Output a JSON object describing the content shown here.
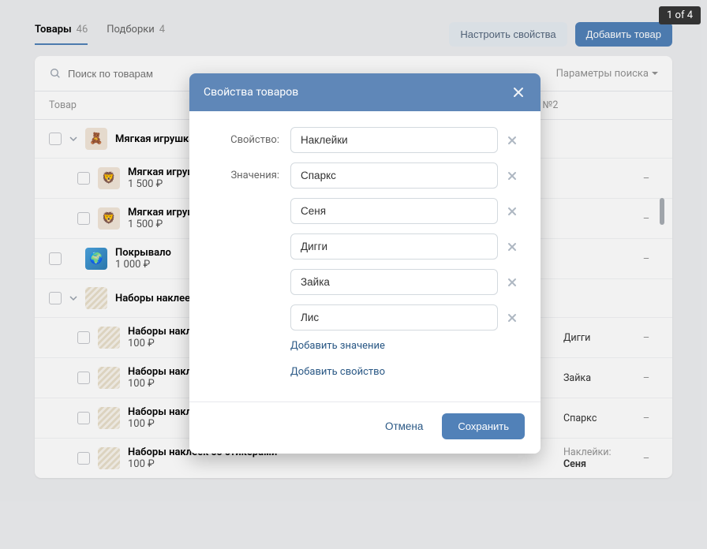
{
  "slide_badge": "1 of 4",
  "tabs": {
    "products": {
      "label": "Товары",
      "count": "46"
    },
    "selections": {
      "label": "Подборки",
      "count": "4"
    }
  },
  "header": {
    "configure": "Настроить свойства",
    "add": "Добавить товар"
  },
  "search": {
    "placeholder": "Поиск по товарам",
    "params": "Параметры поиска"
  },
  "table": {
    "col_item": "Товар",
    "col_prop2": "Свойство №2"
  },
  "rows": [
    {
      "title": "Мягкая игрушка Персик",
      "price": "",
      "type": "group"
    },
    {
      "title": "Мягкая игрушка Персик",
      "price": "1 500 ₽",
      "type": "child",
      "prop1": "",
      "prop2": "–"
    },
    {
      "title": "Мягкая игрушка Персик",
      "price": "1 500 ₽",
      "type": "child",
      "prop1": "",
      "prop2": "–"
    },
    {
      "title": "Покрывало",
      "price": "1 000 ₽",
      "type": "single",
      "prop1": "",
      "prop2": "–"
    },
    {
      "title": "Наборы наклеек со стикерами",
      "price": "",
      "type": "group"
    },
    {
      "title": "Наборы наклеек со стикерами",
      "price": "100 ₽",
      "type": "child",
      "prop1": "Дигги",
      "prop2": "–"
    },
    {
      "title": "Наборы наклеек со стикерами",
      "price": "100 ₽",
      "type": "child",
      "prop1": "Зайка",
      "prop2": "–"
    },
    {
      "title": "Наборы наклеек со стикерами",
      "price": "100 ₽",
      "type": "child",
      "prop1": "Спаркс",
      "prop2": "–"
    },
    {
      "title": "Наборы наклеек со стикерами",
      "price": "100 ₽",
      "type": "child",
      "prop1_prefix": "Наклейки:",
      "prop1": "Сеня",
      "prop2": "–"
    }
  ],
  "modal": {
    "title": "Свойства товаров",
    "property_label": "Свойство:",
    "values_label": "Значения:",
    "property_value": "Наклейки",
    "values": [
      "Спаркс",
      "Сеня",
      "Дигги",
      "Зайка",
      "Лис"
    ],
    "add_value": "Добавить значение",
    "add_property": "Добавить свойство",
    "cancel": "Отмена",
    "save": "Сохранить"
  }
}
